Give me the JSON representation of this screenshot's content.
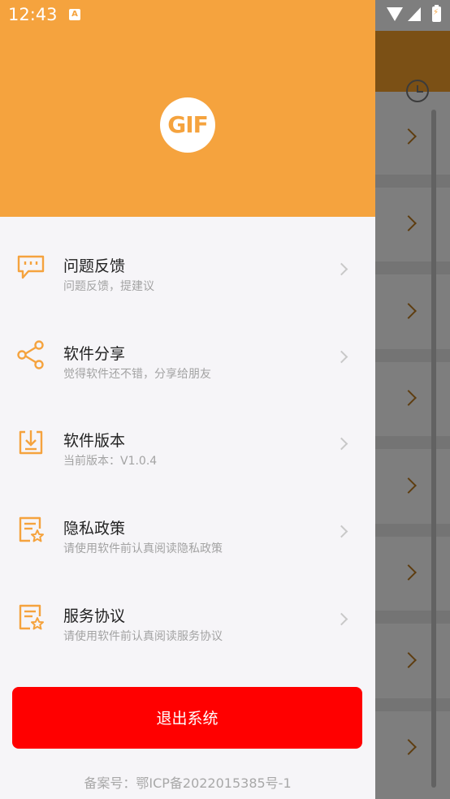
{
  "status_bar": {
    "time": "12:43",
    "notification_letter": "A"
  },
  "header": {
    "logo_text": "GIF"
  },
  "menu": [
    {
      "title": "问题反馈",
      "subtitle": "问题反馈，提建议",
      "icon": "feedback-icon"
    },
    {
      "title": "软件分享",
      "subtitle": "觉得软件还不错，分享给朋友",
      "icon": "share-icon"
    },
    {
      "title": "软件版本",
      "subtitle": "当前版本：V1.0.4",
      "icon": "download-icon"
    },
    {
      "title": "隐私政策",
      "subtitle": "请使用软件前认真阅读隐私政策",
      "icon": "document-icon"
    },
    {
      "title": "服务协议",
      "subtitle": "请使用软件前认真阅读服务协议",
      "icon": "document-icon"
    }
  ],
  "logout_label": "退出系统",
  "footer": "备案号：鄂ICP备2022015385号-1",
  "colors": {
    "accent": "#f5a33e",
    "logout": "#ff0000",
    "drawer_bg": "#f6f5f8"
  }
}
